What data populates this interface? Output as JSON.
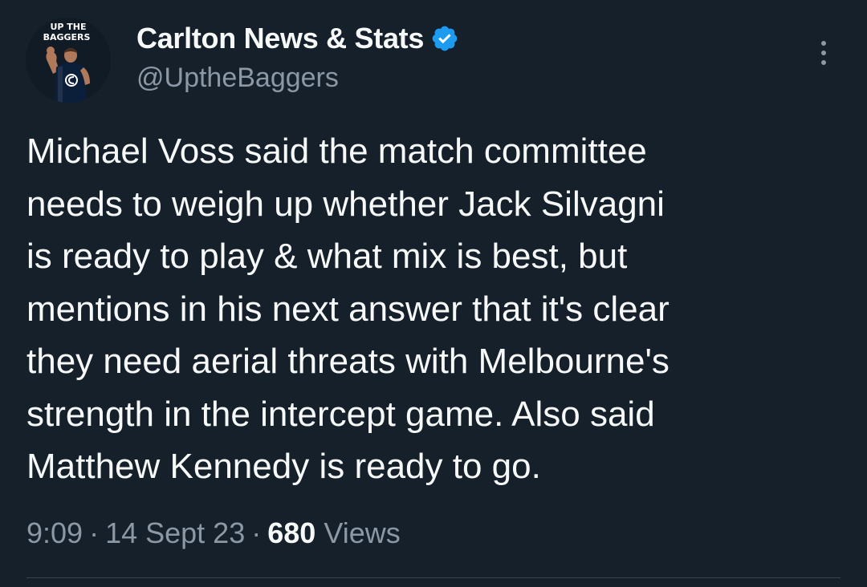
{
  "author": {
    "display_name": "Carlton News & Stats",
    "handle": "@UptheBaggers",
    "verified": true,
    "avatar_text": [
      "UP THE",
      "BAGGERS"
    ]
  },
  "tweet": {
    "text_lines": [
      "Michael Voss said the match committee",
      "needs to weigh up whether Jack Silvagni",
      "is ready to play & what mix is best, but",
      "mentions in his next answer that it's clear",
      "they need aerial threats with Melbourne's",
      "strength in the intercept game. Also said",
      "Matthew Kennedy is ready to go."
    ]
  },
  "meta": {
    "time": "9:09",
    "separator": "·",
    "date": "14 Sept 23",
    "views_count": "680",
    "views_label": "Views"
  },
  "icons": {
    "verified": "verified-badge-icon",
    "more": "more-vertical-icon"
  },
  "colors": {
    "background": "#15202b",
    "text_primary": "#f7f9f9",
    "text_secondary": "#8b98a5",
    "verified_blue": "#1d9bf0",
    "divider": "#38444d"
  }
}
